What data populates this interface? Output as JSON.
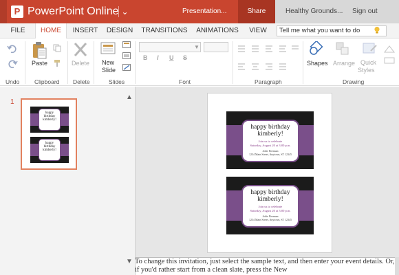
{
  "titlebar": {
    "logo_letter": "P",
    "app_name": "PowerPoint Online",
    "doc_title": "Presentation...",
    "share_label": "Share",
    "account_name": "Healthy Grounds...",
    "signout_label": "Sign out",
    "accent": "#c9452f"
  },
  "tabs": [
    {
      "label": "FILE"
    },
    {
      "label": "HOME"
    },
    {
      "label": "INSERT"
    },
    {
      "label": "DESIGN"
    },
    {
      "label": "TRANSITIONS"
    },
    {
      "label": "ANIMATIONS"
    },
    {
      "label": "VIEW"
    }
  ],
  "active_tab": "HOME",
  "tellme_placeholder": "Tell me what you want to do",
  "ribbon": {
    "groups": [
      {
        "label": "Undo"
      },
      {
        "label": "Clipboard"
      },
      {
        "label": "Delete"
      },
      {
        "label": "Slides"
      },
      {
        "label": "Font"
      },
      {
        "label": "Paragraph"
      },
      {
        "label": "Drawing"
      }
    ],
    "paste_label": "Paste",
    "delete_label": "Delete",
    "new_slide_label_1": "New",
    "new_slide_label_2": "Slide",
    "shapes_label": "Shapes",
    "arrange_label": "Arrange",
    "quick_styles_label_1": "Quick",
    "quick_styles_label_2": "Styles",
    "format_buttons": [
      "B",
      "I",
      "U",
      "S"
    ]
  },
  "slide_panel": {
    "slide_number": "1"
  },
  "card": {
    "heading_line1": "happy birthday",
    "heading_line2": "kimberly!",
    "sub_line1": "Join us to celebrate",
    "sub_line2": "Saturday, August 20 at 3:00 p.m.",
    "addr_line1": "Jodie Brennan",
    "addr_line2": "1234 Main Street, Anytown, ST 12345"
  },
  "notes_text": "To change this invitation, just select the sample text, and then enter your event details. Or, if you'd rather start from a clean slate, press the New"
}
